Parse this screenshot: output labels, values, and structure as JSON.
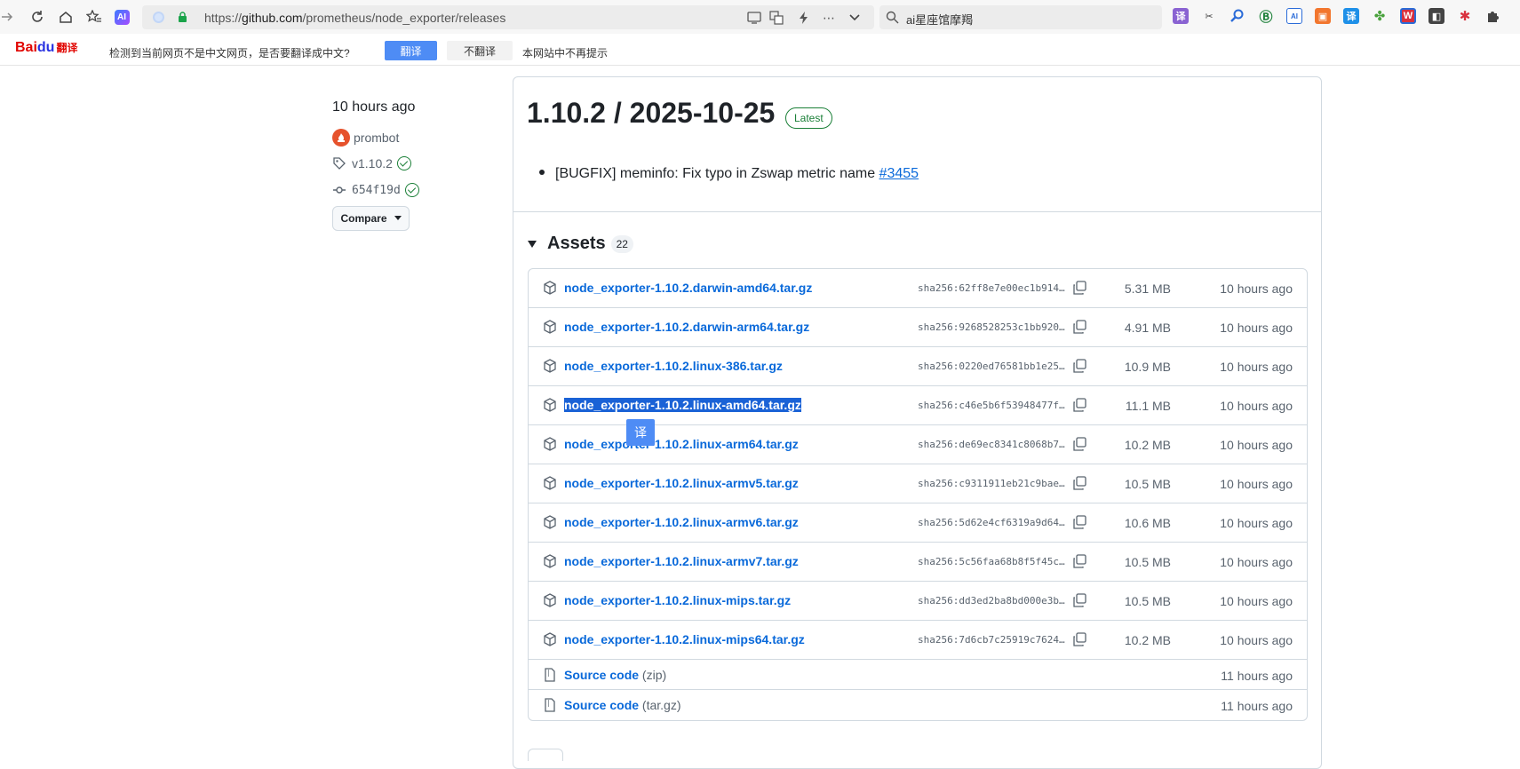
{
  "browser": {
    "url_prefix": "https://",
    "url_host": "github.com",
    "url_path": "/prometheus/node_exporter/releases",
    "search_text": "ai星座馆摩羯"
  },
  "translate_bar": {
    "logo_bai": "Bai",
    "logo_du": "du",
    "logo_fy": "翻译",
    "message": "检测到当前网页不是中文网页，是否要翻译成中文?",
    "translate_label": "翻译",
    "no_translate_label": "不翻译",
    "never_label": "本网站中不再提示"
  },
  "release": {
    "published_ago": "10 hours ago",
    "author": "prombot",
    "tag": "v1.10.2",
    "commit": "654f19d",
    "compare_label": "Compare",
    "title": "1.10.2 / 2025-10-25",
    "badge": "Latest",
    "note_text": "[BUGFIX] meminfo: Fix typo in Zswap metric name ",
    "note_link": "#3455"
  },
  "assets": {
    "label": "Assets",
    "count": "22",
    "items": [
      {
        "name": "node_exporter-1.10.2.darwin-amd64.tar.gz",
        "sha": "sha256:62ff8e7e00ec1b914…",
        "size": "5.31 MB",
        "time": "10 hours ago"
      },
      {
        "name": "node_exporter-1.10.2.darwin-arm64.tar.gz",
        "sha": "sha256:9268528253c1bb920…",
        "size": "4.91 MB",
        "time": "10 hours ago"
      },
      {
        "name": "node_exporter-1.10.2.linux-386.tar.gz",
        "sha": "sha256:0220ed76581bb1e25…",
        "size": "10.9 MB",
        "time": "10 hours ago"
      },
      {
        "name": "node_exporter-1.10.2.linux-amd64.tar.gz",
        "sha": "sha256:c46e5b6f53948477f…",
        "size": "11.1 MB",
        "time": "10 hours ago"
      },
      {
        "name": "node_exporter-1.10.2.linux-arm64.tar.gz",
        "sha": "sha256:de69ec8341c8068b7…",
        "size": "10.2 MB",
        "time": "10 hours ago"
      },
      {
        "name": "node_exporter-1.10.2.linux-armv5.tar.gz",
        "sha": "sha256:c9311911eb21c9bae…",
        "size": "10.5 MB",
        "time": "10 hours ago"
      },
      {
        "name": "node_exporter-1.10.2.linux-armv6.tar.gz",
        "sha": "sha256:5d62e4cf6319a9d64…",
        "size": "10.6 MB",
        "time": "10 hours ago"
      },
      {
        "name": "node_exporter-1.10.2.linux-armv7.tar.gz",
        "sha": "sha256:5c56faa68b8f5f45c…",
        "size": "10.5 MB",
        "time": "10 hours ago"
      },
      {
        "name": "node_exporter-1.10.2.linux-mips.tar.gz",
        "sha": "sha256:dd3ed2ba8bd000e3b…",
        "size": "10.5 MB",
        "time": "10 hours ago"
      },
      {
        "name": "node_exporter-1.10.2.linux-mips64.tar.gz",
        "sha": "sha256:7d6cb7c25919c7624…",
        "size": "10.2 MB",
        "time": "10 hours ago"
      }
    ],
    "source_zip": {
      "name": "Source code",
      "ext": "(zip)",
      "time": "11 hours ago"
    },
    "source_targz": {
      "name": "Source code",
      "ext": "(tar.gz)",
      "time": "11 hours ago"
    }
  },
  "translate_popup": "译",
  "colors": {
    "link": "#0969da",
    "success": "#1a7f37",
    "selection": "#1a62d6",
    "translate_blue": "#4e8cf5"
  }
}
